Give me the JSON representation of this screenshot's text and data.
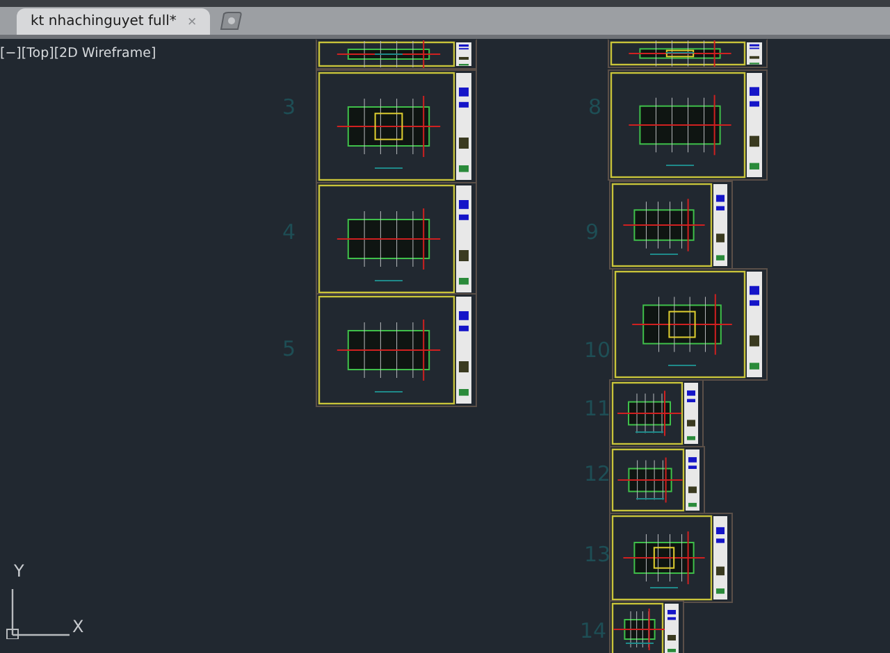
{
  "tabs": [
    {
      "label": "kt nhachinguyet full*",
      "selected": true,
      "close": "×"
    }
  ],
  "viewport": {
    "label": "[−][Top][2D Wireframe]"
  },
  "sheets": [
    {
      "kind": "cut"
    },
    {
      "number": "3"
    },
    {
      "number": "4"
    },
    {
      "number": "5"
    },
    {
      "kind": "cut"
    },
    {
      "number": "8"
    },
    {
      "number": "9"
    },
    {
      "number": "10"
    },
    {
      "number": "11"
    },
    {
      "number": "12"
    },
    {
      "number": "13"
    },
    {
      "number": "14"
    }
  ],
  "ucs": {
    "y": "Y",
    "x": "X"
  }
}
